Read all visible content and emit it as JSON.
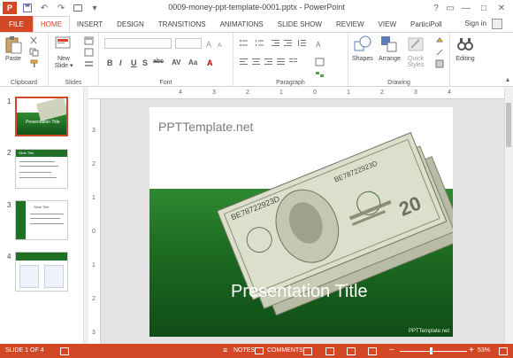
{
  "window": {
    "title": "0009-money-ppt-template-0001.pptx - PowerPoint",
    "logo": "P",
    "controls": [
      "?",
      "▭",
      "—",
      "□",
      "✕"
    ]
  },
  "tabs": [
    "FILE",
    "HOME",
    "INSERT",
    "DESIGN",
    "TRANSITIONS",
    "ANIMATIONS",
    "SLIDE SHOW",
    "REVIEW",
    "VIEW",
    "ParticiPoll"
  ],
  "signin": "Sign in",
  "ribbon": {
    "clipboard": {
      "paste": "Paste",
      "label": "Clipboard"
    },
    "slides": {
      "new_slide_1": "New",
      "new_slide_2": "Slide ▾",
      "label": "Slides"
    },
    "font": {
      "label": "Font",
      "bold": "B",
      "italic": "I",
      "underline": "U",
      "strike": "S",
      "shadow": "abc",
      "spacing": "AV",
      "case": "Aa",
      "color": "A"
    },
    "paragraph": {
      "label": "Paragraph"
    },
    "drawing": {
      "shapes": "Shapes",
      "arrange": "Arrange",
      "quick_1": "Quick",
      "quick_2": "Styles",
      "label": "Drawing"
    },
    "editing": {
      "label": "Editing"
    }
  },
  "thumbnails": [
    {
      "num": "1",
      "title": "Presentation Title"
    },
    {
      "num": "2",
      "title": "Slide Title"
    },
    {
      "num": "3",
      "title": "Slide Title"
    },
    {
      "num": "4",
      "title": ""
    }
  ],
  "ruler": {
    "h": [
      "4",
      "3",
      "2",
      "1",
      "0",
      "1",
      "2",
      "3",
      "4"
    ],
    "v": [
      "3",
      "2",
      "1",
      "0",
      "1",
      "2",
      "3"
    ]
  },
  "slide": {
    "brand": "PPTTemplate.net",
    "title": "Presentation Title",
    "footer": "PPTTemplate.net",
    "note_serials": [
      "BE78722923D",
      "BE78722923D"
    ],
    "note_denom": "20",
    "colors": {
      "green_top": "#2f8a31",
      "green_bottom": "#0f4d16",
      "bill": "#d9dcc6"
    }
  },
  "status": {
    "slide": "SLIDE 1 OF 4",
    "notes": "NOTES",
    "comments": "COMMENTS",
    "zoom": "53%",
    "accent": "#d24726"
  }
}
